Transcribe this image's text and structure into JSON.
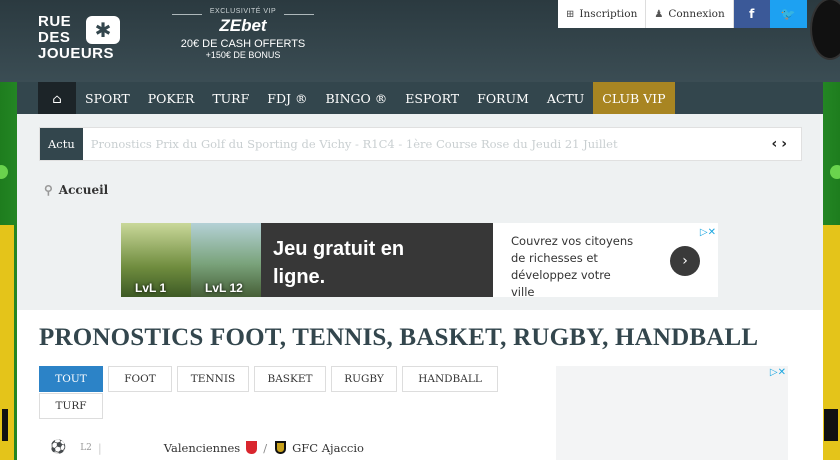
{
  "header": {
    "logo_line1": "RUE",
    "logo_line2": "DES",
    "logo_line3": "JOUEURS",
    "promo_exclusive": "EXCLUSIVITÉ VIP",
    "promo_brand": "ZEbet",
    "promo_cash": "20€ DE CASH OFFERTS",
    "promo_bonus": "+150€ DE BONUS",
    "inscription_label": "Inscription",
    "connexion_label": "Connexion",
    "facebook_label": "f"
  },
  "nav": {
    "items": [
      "SPORT",
      "POKER",
      "TURF",
      "FDJ ®",
      "BINGO ®",
      "ESPORT",
      "FORUM",
      "ACTU",
      "CLUB VIP"
    ]
  },
  "ticker": {
    "label": "Actu",
    "text": "Pronostics Prix du Golf du Sporting de Vichy - R1C4 - 1ère Course Rose du Jeudi 21 Juillet"
  },
  "breadcrumb": {
    "home": "Accueil"
  },
  "ad": {
    "lvl1": "LvL 1",
    "lvl2": "LvL 12",
    "headline_line1": "Jeu gratuit en",
    "headline_line2": "ligne.",
    "desc_line1": "Couvrez vos citoyens",
    "desc_line2": "de richesses et",
    "desc_line3": "développez votre",
    "desc_line4": "ville"
  },
  "page": {
    "title": "PRONOSTICS FOOT, TENNIS, BASKET, RUGBY, HANDBALL"
  },
  "filters": {
    "tabs": [
      "TOUT",
      "FOOT",
      "TENNIS",
      "BASKET",
      "RUGBY",
      "HANDBALL",
      "TURF"
    ],
    "active": "TOUT"
  },
  "match": {
    "league": "L2",
    "home": "Valenciennes",
    "separator": "/",
    "away": "GFC Ajaccio"
  },
  "colors": {
    "header_bg": "#33464d",
    "vip_gold": "#a88522",
    "active_tab": "#2c83c7",
    "facebook": "#3b5998",
    "twitter": "#1da1f2"
  }
}
